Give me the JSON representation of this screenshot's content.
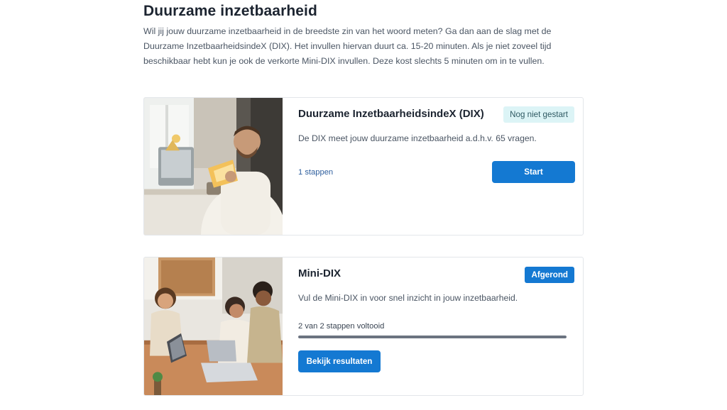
{
  "header": {
    "title": "Duurzame inzetbaarheid",
    "intro": "Wil jij jouw duurzame inzetbaarheid in de breedste zin van het woord meten? Ga dan aan de slag met de Duurzame InzetbaarheidsindeX (DIX). Het invullen hiervan duurt ca. 15-20 minuten. Als je niet zoveel tijd beschikbaar hebt kun je ook de verkorte Mini-DIX invullen. Deze kost slechts 5 minuten om in te vullen."
  },
  "cards": [
    {
      "title": "Duurzame InzetbaarheidsindeX (DIX)",
      "badge": "Nog niet gestart",
      "description": "De DIX meet jouw duurzame inzetbaarheid a.d.h.v. 65 vragen.",
      "steps": "1 stappen",
      "button": "Start",
      "image": "man-reading-at-desk-photo"
    },
    {
      "title": "Mini-DIX",
      "badge": "Afgerond",
      "description": "Vul de Mini-DIX in voor snel inzicht in jouw inzetbaarheid.",
      "progress_label": "2 van 2 stappen voltooid",
      "progress_fraction": 1.0,
      "button": "Bekijk resultaten",
      "image": "team-meeting-laptops-photo"
    }
  ],
  "colors": {
    "accent": "#1479d2",
    "badge_pending_bg": "#dcf4f6",
    "progress_fill": "#6b7380"
  }
}
